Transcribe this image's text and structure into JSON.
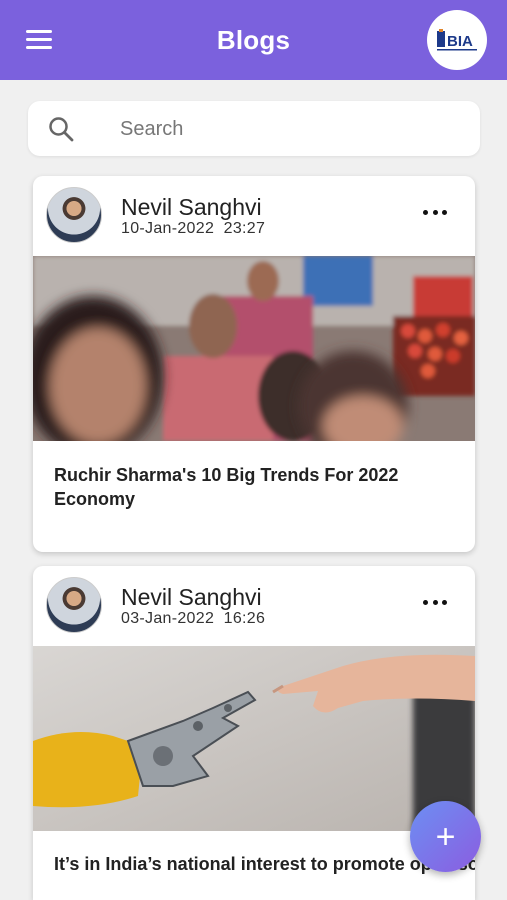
{
  "appbar": {
    "title": "Blogs",
    "menu_icon": "hamburger-menu-icon",
    "logo_text": "BIA"
  },
  "search": {
    "placeholder": "Search",
    "icon": "search-icon"
  },
  "posts": [
    {
      "author": "Nevil Sanghvi",
      "date": "10-Jan-2022",
      "time": "23:27",
      "title": "Ruchir Sharma's 10 Big Trends For 2022 Economy"
    },
    {
      "author": "Nevil Sanghvi",
      "date": "03-Jan-2022",
      "time": "16:26",
      "title": "It’s in India’s national interest to promote open source software"
    }
  ],
  "fab": {
    "icon": "plus-icon",
    "label": "+"
  },
  "colors": {
    "primary": "#7b61dd",
    "background": "#f0f0f0",
    "fab_start": "#6c8ff3",
    "fab_end": "#8b5de0"
  }
}
